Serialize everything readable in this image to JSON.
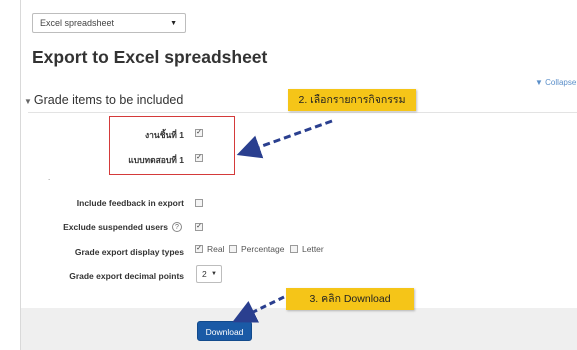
{
  "format_select": {
    "value": "Excel spreadsheet"
  },
  "page_title": "Export to Excel spreadsheet",
  "collapse_all": "Collapse",
  "section": {
    "title": "Grade items to be included"
  },
  "annotations": {
    "step2": "2. เลือกรายการกิจกรรม",
    "step3": "3. คลิก Download"
  },
  "grade_items": [
    {
      "label": "งานชิ้นที่ 1",
      "checked": true
    },
    {
      "label": "แบบทดสอบที่ 1",
      "checked": true
    }
  ],
  "options": {
    "include_feedback": {
      "label": "Include feedback in export",
      "checked": false
    },
    "exclude_suspended": {
      "label": "Exclude suspended users",
      "checked": true
    },
    "display_types": {
      "label": "Grade export display types",
      "choices": [
        {
          "label": "Real",
          "checked": true
        },
        {
          "label": "Percentage",
          "checked": false
        },
        {
          "label": "Letter",
          "checked": false
        }
      ]
    },
    "decimal_points": {
      "label": "Grade export decimal points",
      "value": "2"
    }
  },
  "download_button": "Download",
  "colors": {
    "annotation": "#f5c518",
    "highlight_box": "#d43a3a",
    "button": "#1a5aa6",
    "arrow": "#2a3f8f"
  },
  "icons": [
    "chevron-down-icon",
    "collapse-triangle-icon",
    "help-icon",
    "checkbox-checked-icon",
    "checkbox-unchecked-icon",
    "dashed-arrow-icon"
  ]
}
